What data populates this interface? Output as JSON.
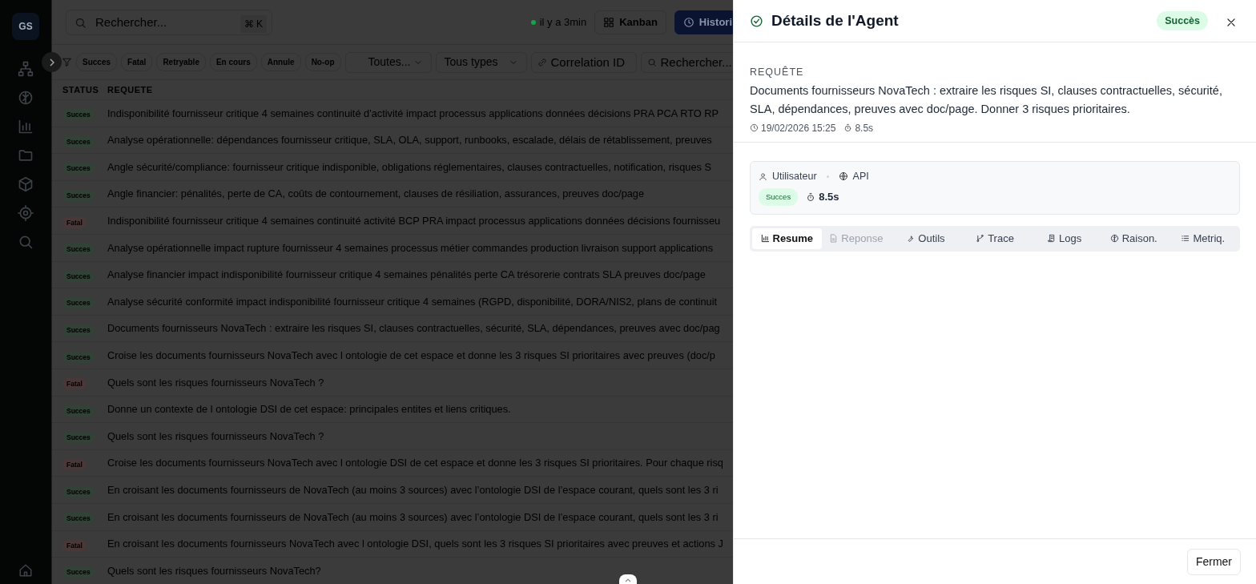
{
  "sidebar": {
    "logo": "GS"
  },
  "topbar": {
    "search": {
      "placeholder": "Rechercher...",
      "shortcut": "⌘ K"
    },
    "updated": "il y a 3min",
    "views": [
      {
        "label": "Kanban",
        "selected": false
      },
      {
        "label": "Histori",
        "selected": true
      }
    ]
  },
  "filters": {
    "chips": [
      "Succes",
      "Fatal",
      "Retryable",
      "En cours",
      "Annule",
      "No-op"
    ],
    "selects": [
      "Toutes...",
      "Tous types"
    ],
    "correlation": {
      "placeholder": "Correlation ID"
    },
    "search": {
      "placeholder": "Rechercher..."
    }
  },
  "table": {
    "columns": [
      "STATUS",
      "REQUETE"
    ],
    "rows": [
      {
        "kind": "success",
        "badge": "Succes",
        "request": "Indisponibilité fournisseur critique 4 semaines continuité d'activité impact processus applications données décisions PRA PCA RTO RP"
      },
      {
        "kind": "success",
        "badge": "Succes",
        "request": "Analyse opérationnelle: dépendances fournisseur critique, SLA, OLA, support, runbooks, escalade, délais de rétablissement, preuves"
      },
      {
        "kind": "success",
        "badge": "Succes",
        "request": "Angle sécurité/compliance: fournisseur critique indisponible, obligations réglementaires, clauses contractuelles, notification, risques S"
      },
      {
        "kind": "success",
        "badge": "Succes",
        "request": "Angle financier: pénalités, perte de CA, coûts de contournement, clauses de résiliation, assurances, preuves doc/page"
      },
      {
        "kind": "fatal",
        "badge": "Fatal",
        "request": "Indisponibilité fournisseur critique 4 semaines continuité activité BCP PRA impact processus applications données décisions fournisseu"
      },
      {
        "kind": "success",
        "badge": "Succes",
        "request": "Analyse opérationnelle impact rupture fournisseur 4 semaines processus métier commandes production livraison support applications"
      },
      {
        "kind": "success",
        "badge": "Succes",
        "request": "Analyse financier impact indisponibilité fournisseur critique 4 semaines pénalités perte CA trésorerie contrats SLA preuves doc/page"
      },
      {
        "kind": "success",
        "badge": "Succes",
        "request": "Analyse sécurité conformité impact indisponibilité fournisseur critique 4 semaines (RGPD, disponibilité, DORA/NIS2, plans de continuit"
      },
      {
        "kind": "success",
        "badge": "Succes",
        "request": "Documents fournisseurs NovaTech : extraire les risques SI, clauses contractuelles, sécurité, SLA, dépendances, preuves avec doc/pag"
      },
      {
        "kind": "success",
        "badge": "Succes",
        "request": "Croise les documents fournisseurs NovaTech avec l ontologie de cet espace et donne les 3 risques SI prioritaires avec preuves (doc/p"
      },
      {
        "kind": "fatal",
        "badge": "Fatal",
        "request": "Quels sont les risques fournisseurs NovaTech ?"
      },
      {
        "kind": "success",
        "badge": "Succes",
        "request": "Donne un contexte de l ontologie DSI de cet espace: principales entites et liens critiques."
      },
      {
        "kind": "success",
        "badge": "Succes",
        "request": "Quels sont les risques fournisseurs NovaTech ?"
      },
      {
        "kind": "fatal",
        "badge": "Fatal",
        "request": "Croise les documents fournisseurs NovaTech avec l ontologie DSI de cet espace et donne les 3 risques SI prioritaires. Pour chaque risq"
      },
      {
        "kind": "success",
        "badge": "Succes",
        "request": "En croisant les documents fournisseurs de NovaTech (au moins 3 sources) avec l’ontologie DSI de l’espace courant, quels sont les 3 ri"
      },
      {
        "kind": "success",
        "badge": "Succes",
        "request": "En croisant les documents fournisseurs de NovaTech (au moins 3 sources) avec l’ontologie DSI de l’espace courant, quels sont les 3 ri"
      },
      {
        "kind": "fatal",
        "badge": "Fatal",
        "request": "En croisant les documents fournisseurs NovaTech avec l ontologie DSI, quels sont les 3 risques SI prioritaires avec preuves et actions J"
      },
      {
        "kind": "success",
        "badge": "Succes",
        "request": "Quels sont les risques fournisseurs NovaTech?"
      }
    ]
  },
  "drawer": {
    "title": "Détails de l'Agent",
    "status_badge": "Succès",
    "request_label": "REQUÊTE",
    "request": "Documents fournisseurs NovaTech : extraire les risques SI, clauses contractuelles, sécurité, SLA, dépendances, preuves avec doc/page. Donner 3 risques prioritaires.",
    "date": "19/02/2026 15:25",
    "duration": "8.5s",
    "card": {
      "source": "Utilisateur",
      "channel": "API",
      "badge": "Succes",
      "duration": "8.5s"
    },
    "tabs": [
      {
        "label": "Resume",
        "selected": true,
        "disabled": false
      },
      {
        "label": "Reponse",
        "selected": false,
        "disabled": true
      },
      {
        "label": "Outils",
        "selected": false,
        "disabled": false
      },
      {
        "label": "Trace",
        "selected": false,
        "disabled": false
      },
      {
        "label": "Logs",
        "selected": false,
        "disabled": false
      },
      {
        "label": "Raison.",
        "selected": false,
        "disabled": false
      },
      {
        "label": "Metriq.",
        "selected": false,
        "disabled": false
      }
    ],
    "close_button": "Fermer"
  }
}
